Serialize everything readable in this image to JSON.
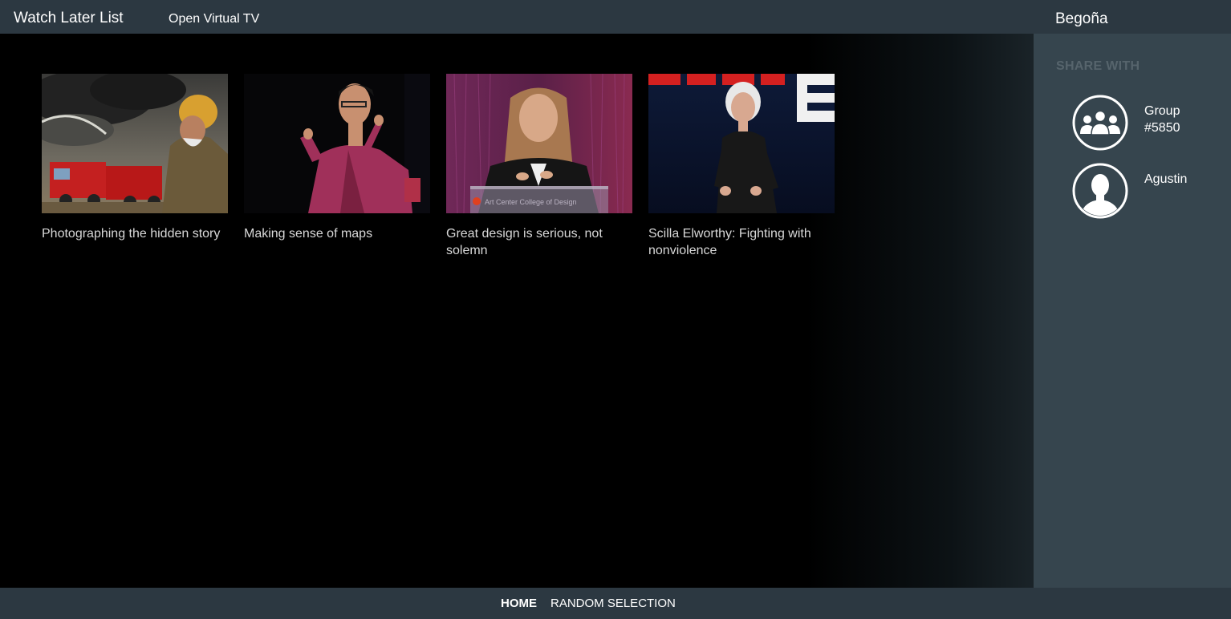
{
  "header": {
    "title": "Watch Later List",
    "open_tv_label": "Open Virtual TV",
    "user_name": "Begoña"
  },
  "videos": [
    {
      "title": "Photographing the hidden story"
    },
    {
      "title": "Making sense of maps"
    },
    {
      "title": "Great design is serious, not solemn",
      "thumb_caption": "Art Center College of Design"
    },
    {
      "title": "Scilla Elworthy: Fighting with nonviolence"
    }
  ],
  "sidebar": {
    "heading": "SHARE WITH",
    "contacts": [
      {
        "label": "Group #5850",
        "icon": "group-icon"
      },
      {
        "label": "Agustin",
        "icon": "person-icon"
      }
    ]
  },
  "footer": {
    "nav": [
      {
        "label": "HOME",
        "active": true
      },
      {
        "label": "RANDOM SELECTION",
        "active": false
      }
    ]
  },
  "colors": {
    "bar_bg": "#2c3841",
    "sidebar_bg": "#36454e",
    "main_bg": "#000000",
    "muted_heading": "#56646c"
  }
}
